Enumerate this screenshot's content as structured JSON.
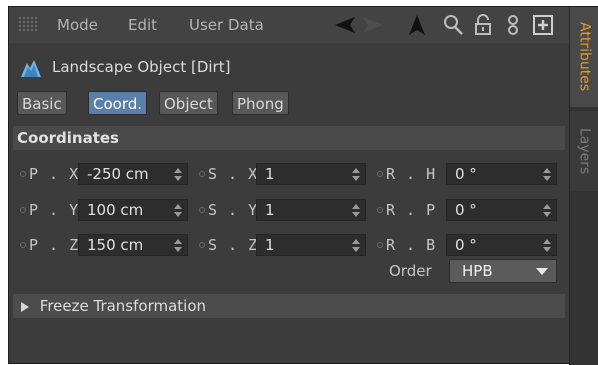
{
  "menu": {
    "items": [
      "Mode",
      "Edit",
      "User Data"
    ],
    "tools": [
      "back-arrow-icon",
      "forward-arrow-icon",
      "cursor-up-icon",
      "search-icon",
      "lock-icon",
      "link-icon",
      "new-panel-icon"
    ]
  },
  "object": {
    "icon": "landscape-icon",
    "title": "Landscape Object [Dirt]"
  },
  "tabs": [
    {
      "label": "Basic",
      "active": false
    },
    {
      "label": "Coord.",
      "active": true
    },
    {
      "label": "Object",
      "active": false
    },
    {
      "label": "Phong",
      "active": false
    }
  ],
  "section": {
    "title": "Coordinates"
  },
  "coords": {
    "px": {
      "label": "P . X",
      "value": "-250 cm"
    },
    "py": {
      "label": "P . Y",
      "value": "100 cm"
    },
    "pz": {
      "label": "P . Z",
      "value": "150 cm"
    },
    "sx": {
      "label": "S . X",
      "value": "1"
    },
    "sy": {
      "label": "S . Y",
      "value": "1"
    },
    "sz": {
      "label": "S . Z",
      "value": "1"
    },
    "rh": {
      "label": "R . H",
      "value": "0 °"
    },
    "rp": {
      "label": "R . P",
      "value": "0 °"
    },
    "rb": {
      "label": "R . B",
      "value": "0 °"
    }
  },
  "order": {
    "label": "Order",
    "value": "HPB"
  },
  "freeze": {
    "label": "Freeze Transformation"
  },
  "side_tabs": {
    "attributes": "Attributes",
    "layers": "Layers"
  },
  "colors": {
    "active_tab": "#5a7fa8",
    "side_active_text": "#e39a28"
  }
}
